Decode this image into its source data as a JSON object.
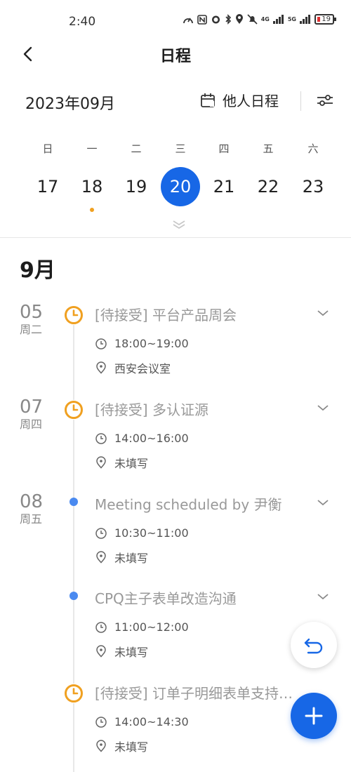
{
  "status_bar": {
    "time": "2:40",
    "network_label": "4G",
    "network_label2": "5G",
    "battery": "19"
  },
  "header": {
    "title": "日程"
  },
  "calendar": {
    "month_label": "2023年09月",
    "others_label": "他人日程",
    "weekday_names": [
      "日",
      "一",
      "二",
      "三",
      "四",
      "五",
      "六"
    ],
    "days": [
      "17",
      "18",
      "19",
      "20",
      "21",
      "22",
      "23"
    ],
    "selected_day": "20",
    "dot_day": "18",
    "accent": "#1767e6"
  },
  "agenda": {
    "month_heading": "9月",
    "dates": [
      {
        "day": "05",
        "weekday": "周二"
      },
      {
        "day": "07",
        "weekday": "周四"
      },
      {
        "day": "08",
        "weekday": "周五"
      }
    ],
    "events": [
      {
        "title": "[待接受] 平台产品周会",
        "time": "18:00~19:00",
        "location": "西安会议室",
        "marker": "pending-clock-icon"
      },
      {
        "title": "[待接受] 多认证源",
        "time": "14:00~16:00",
        "location": "未填写",
        "marker": "pending-clock-icon"
      },
      {
        "title": "Meeting scheduled by 尹衡",
        "time": "10:30~11:00",
        "location": "未填写",
        "marker": "dot"
      },
      {
        "title": "CPQ主子表单改造沟通",
        "time": "11:00~12:00",
        "location": "未填写",
        "marker": "dot"
      },
      {
        "title": "[待接受] 订单子明细表单支持…",
        "time": "14:00~14:30",
        "location": "未填写",
        "marker": "pending-clock-icon"
      }
    ]
  },
  "colors": {
    "pending": "#f0a020",
    "dot": "#4a8af0",
    "fab": "#1767e6"
  }
}
